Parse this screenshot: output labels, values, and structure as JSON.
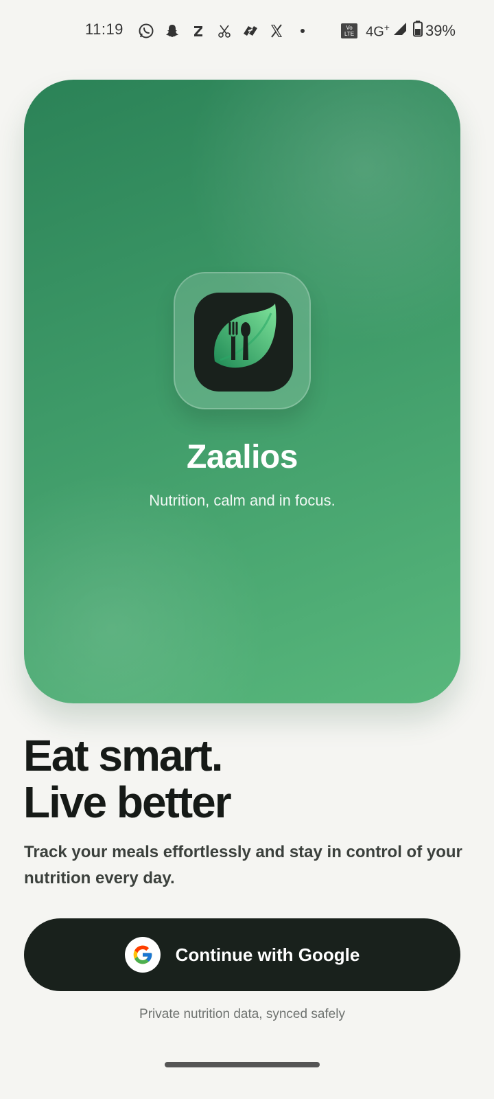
{
  "status_bar": {
    "time": "11:19",
    "notification_icons": [
      "whatsapp-icon",
      "snapchat-icon",
      "zomato-icon",
      "scissors-icon",
      "linked-app-icon",
      "x-icon",
      "dot-icon"
    ],
    "volte_label": "Vo LTE",
    "network_type": "4G",
    "network_plus": "+",
    "battery_percent": "39%"
  },
  "hero": {
    "app_name": "Zaalios",
    "tagline": "Nutrition, calm and in focus.",
    "colors": {
      "gradient_start": "#2b8257",
      "gradient_end": "#58b77c",
      "logo_bg": "#19211c",
      "leaf_light": "#6fd38d",
      "leaf_dark": "#1f8a55"
    }
  },
  "headline": {
    "line1": "Eat smart.",
    "line2": "Live better"
  },
  "description": "Track your meals effortlessly and stay in control of your nutrition every day.",
  "google_button": {
    "label": "Continue with Google",
    "icon": "google-icon",
    "background": "#19211c"
  },
  "privacy_note": "Private nutrition data, synced safely"
}
